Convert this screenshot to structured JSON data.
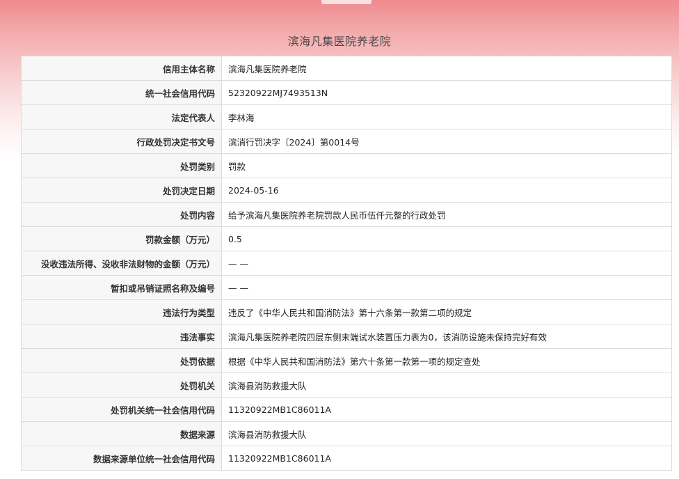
{
  "page": {
    "title": "滨海凡集医院养老院"
  },
  "rows": [
    {
      "label": "信用主体名称",
      "value": "滨海凡集医院养老院"
    },
    {
      "label": "统一社会信用代码",
      "value": "52320922MJ7493513N"
    },
    {
      "label": "法定代表人",
      "value": "李林海"
    },
    {
      "label": "行政处罚决定书文号",
      "value": "滨消行罚决字〔2024〕第0014号"
    },
    {
      "label": "处罚类别",
      "value": "罚款"
    },
    {
      "label": "处罚决定日期",
      "value": "2024-05-16"
    },
    {
      "label": "处罚内容",
      "value": "给予滨海凡集医院养老院罚款人民币伍仟元整的行政处罚"
    },
    {
      "label": "罚款金额（万元）",
      "value": "0.5"
    },
    {
      "label": "没收违法所得、没收非法财物的金额（万元）",
      "value": "— —"
    },
    {
      "label": "暂扣或吊销证照名称及编号",
      "value": "— —"
    },
    {
      "label": "违法行为类型",
      "value": "违反了《中华人民共和国消防法》第十六条第一款第二项的规定"
    },
    {
      "label": "违法事实",
      "value": "滨海凡集医院养老院四层东侧末端试水装置压力表为0，该消防设施未保持完好有效"
    },
    {
      "label": "处罚依据",
      "value": "根据《中华人民共和国消防法》第六十条第一款第一项的规定查处"
    },
    {
      "label": "处罚机关",
      "value": "滨海县消防救援大队"
    },
    {
      "label": "处罚机关统一社会信用代码",
      "value": "11320922MB1C86011A"
    },
    {
      "label": "数据来源",
      "value": "滨海县消防救援大队"
    },
    {
      "label": "数据来源单位统一社会信用代码",
      "value": "11320922MB1C86011A"
    }
  ]
}
